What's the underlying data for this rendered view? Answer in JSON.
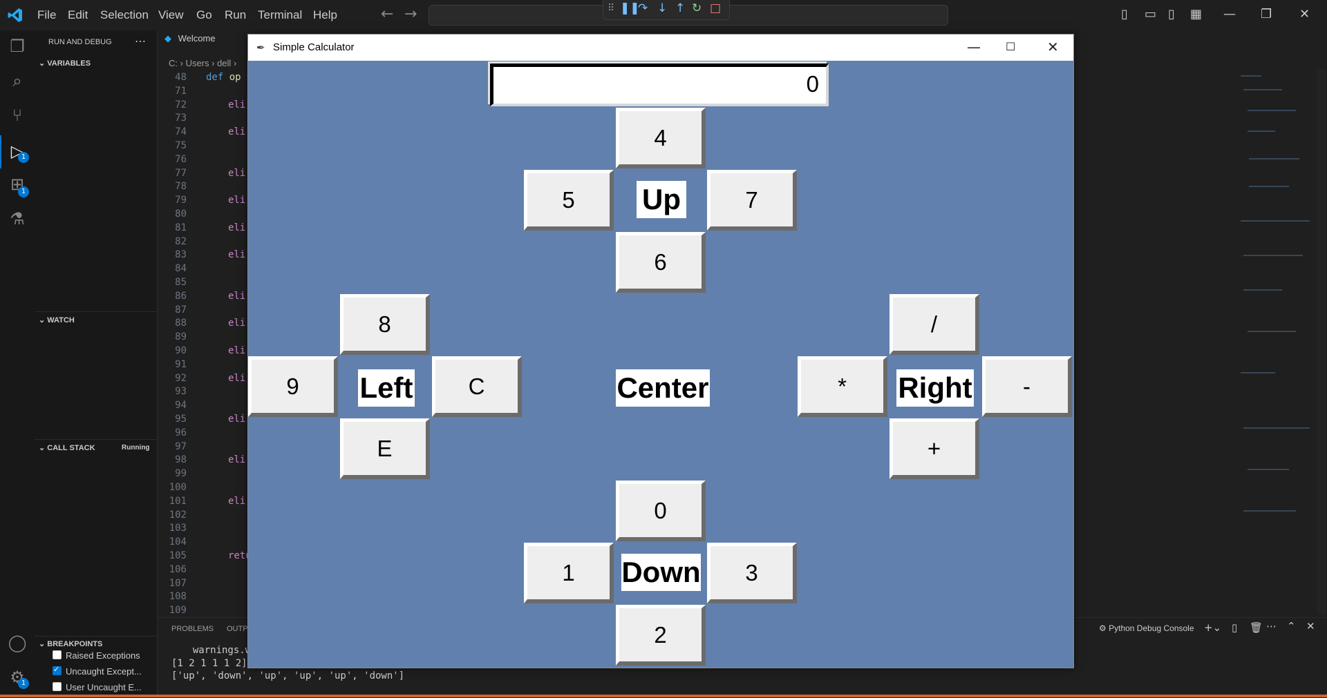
{
  "menu": [
    "File",
    "Edit",
    "Selection",
    "View",
    "Go",
    "Run",
    "Terminal",
    "Help"
  ],
  "sidebar": {
    "title": "RUN AND DEBUG",
    "variables": "VARIABLES",
    "watch": "WATCH",
    "call_stack": "CALL STACK",
    "call_stack_status": "Running",
    "breakpoints": "BREAKPOINTS",
    "bp_items": [
      {
        "label": "Raised Exceptions",
        "checked": false
      },
      {
        "label": "Uncaught Except...",
        "checked": true
      },
      {
        "label": "User Uncaught E...",
        "checked": false
      }
    ],
    "badges": {
      "debug": "1",
      "extensions": "1",
      "settings": "1"
    }
  },
  "editor": {
    "tab": "Welcome",
    "breadcrumb": [
      "C:",
      "Users",
      "dell"
    ],
    "line_numbers": [
      "48",
      "71",
      "72",
      "73",
      "74",
      "75",
      "76",
      "77",
      "78",
      "79",
      "80",
      "81",
      "82",
      "83",
      "84",
      "85",
      "86",
      "87",
      "88",
      "89",
      "90",
      "91",
      "92",
      "93",
      "94",
      "95",
      "96",
      "97",
      "98",
      "99",
      "100",
      "101",
      "102",
      "103",
      "104",
      "105",
      "106",
      "107",
      "108",
      "109"
    ],
    "def_kw": "def",
    "def_name": "op",
    "elif_kw": "eli",
    "return_kw": "retu"
  },
  "panel": {
    "tabs": [
      "PROBLEMS",
      "OUTP"
    ],
    "console_label": "Python Debug Console",
    "lines": [
      "  warnings.war",
      "[1 2 1 1 1 2]",
      "['up', 'down', 'up', 'up', 'up', 'down']"
    ]
  },
  "calculator": {
    "title": "Simple Calculator",
    "display": "0",
    "up_group": {
      "label": "Up",
      "top": "4",
      "left": "5",
      "right": "7",
      "bottom": "6"
    },
    "left_group": {
      "label": "Left",
      "top": "8",
      "left": "9",
      "right": "C",
      "bottom": "E"
    },
    "center_label": "Center",
    "right_group": {
      "label": "Right",
      "top": "/",
      "left": "*",
      "right": "-",
      "bottom": "+"
    },
    "down_group": {
      "label": "Down",
      "top": "0",
      "left": "1",
      "right": "3",
      "bottom": "2"
    }
  }
}
